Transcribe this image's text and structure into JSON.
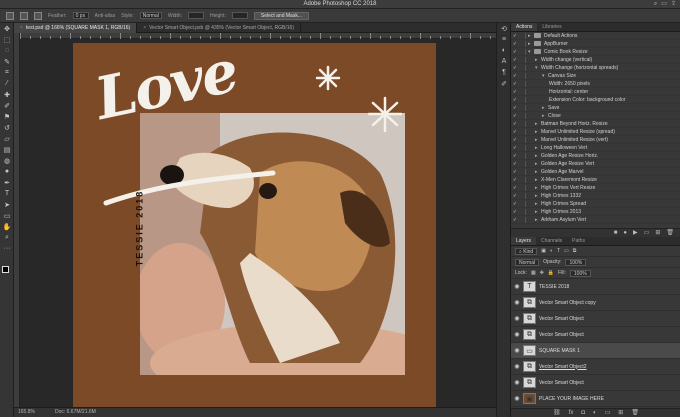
{
  "window": {
    "title": "Adobe Photoshop CC 2018"
  },
  "options_bar": {
    "feather_label": "Feather:",
    "feather_value": "0 px",
    "antialias_label": "Anti-alias",
    "style_label": "Style:",
    "style_value": "Normal",
    "width_label": "Width:",
    "height_label": "Height:",
    "select_mask_label": "Select and Mask..."
  },
  "tabs": [
    {
      "label": "test.psd @ 166% (SQUARE MASK 1, RGB/16)",
      "active": true
    },
    {
      "label": "Vector Smart Object.psb @ 435% (Vector Smart Object, RGB/16)",
      "active": false
    }
  ],
  "canvas": {
    "love_text": "Love",
    "vertical_text": "TESSIE 2018",
    "background_color": "#7c4a26"
  },
  "status": {
    "zoom": "165.8%",
    "doc": "Doc: 6.67M/21.6M"
  },
  "panels": {
    "top_tabs": [
      "Actions",
      "Libraries"
    ],
    "actions": [
      {
        "label": "Default Actions",
        "level": 0,
        "type": "set"
      },
      {
        "label": "AppBurner",
        "level": 0,
        "type": "set"
      },
      {
        "label": "Comic Book Resize",
        "level": 0,
        "type": "set"
      },
      {
        "label": "Width change (vertical)",
        "level": 1,
        "type": "action"
      },
      {
        "label": "Width Change (horizontal spreads)",
        "level": 1,
        "type": "action"
      },
      {
        "label": "Canvas Size",
        "level": 2,
        "type": "step"
      },
      {
        "label": "Width: 2650 pixels",
        "level": 3,
        "type": "detail"
      },
      {
        "label": "Horizontal: center",
        "level": 3,
        "type": "detail"
      },
      {
        "label": "Extension Color: background color",
        "level": 3,
        "type": "detail"
      },
      {
        "label": "Save",
        "level": 2,
        "type": "step"
      },
      {
        "label": "Close",
        "level": 2,
        "type": "step"
      },
      {
        "label": "Batman Beyond Horiz. Resize",
        "level": 1,
        "type": "action"
      },
      {
        "label": "Marvel Unlimited Resize (spread)",
        "level": 1,
        "type": "action"
      },
      {
        "label": "Marvel Unlimited Resize (vert)",
        "level": 1,
        "type": "action"
      },
      {
        "label": "Long Halloween Vert",
        "level": 1,
        "type": "action"
      },
      {
        "label": "Golden Age Resize Horiz.",
        "level": 1,
        "type": "action"
      },
      {
        "label": "Golden Age Resize Vert",
        "level": 1,
        "type": "action"
      },
      {
        "label": "Golden Age Marvel",
        "level": 1,
        "type": "action"
      },
      {
        "label": "X-Men Claremont Resize",
        "level": 1,
        "type": "action"
      },
      {
        "label": "High Crimes Vert Resize",
        "level": 1,
        "type": "action"
      },
      {
        "label": "High Crimes 1332",
        "level": 1,
        "type": "action"
      },
      {
        "label": "High Crimes Spread",
        "level": 1,
        "type": "action"
      },
      {
        "label": "High Crimes 2013",
        "level": 1,
        "type": "action"
      },
      {
        "label": "Arkham Asylum Vert",
        "level": 1,
        "type": "action"
      }
    ],
    "layer_tabs": [
      "Layers",
      "Channels",
      "Paths"
    ],
    "kind_label": "Kind",
    "blend_mode": "Normal",
    "opacity_label": "Opacity:",
    "opacity_value": "100%",
    "lock_label": "Lock:",
    "fill_label": "Fill:",
    "fill_value": "100%",
    "layers": [
      {
        "name": "TESSIE 2018",
        "kind": "text",
        "selected": false
      },
      {
        "name": "Vector Smart Object copy",
        "kind": "smart",
        "selected": false
      },
      {
        "name": "Vector Smart Object",
        "kind": "smart",
        "selected": false
      },
      {
        "name": "Vector Smart Object",
        "kind": "smart",
        "selected": false
      },
      {
        "name": "SQUARE MASK 1",
        "kind": "shape",
        "selected": true
      },
      {
        "name": "Vector Smart Object2",
        "kind": "smart",
        "selected": false
      },
      {
        "name": "Vector Smart Object",
        "kind": "smart",
        "selected": false
      },
      {
        "name": "PLACE YOUR IMAGE HERE",
        "kind": "image",
        "selected": false
      }
    ]
  }
}
